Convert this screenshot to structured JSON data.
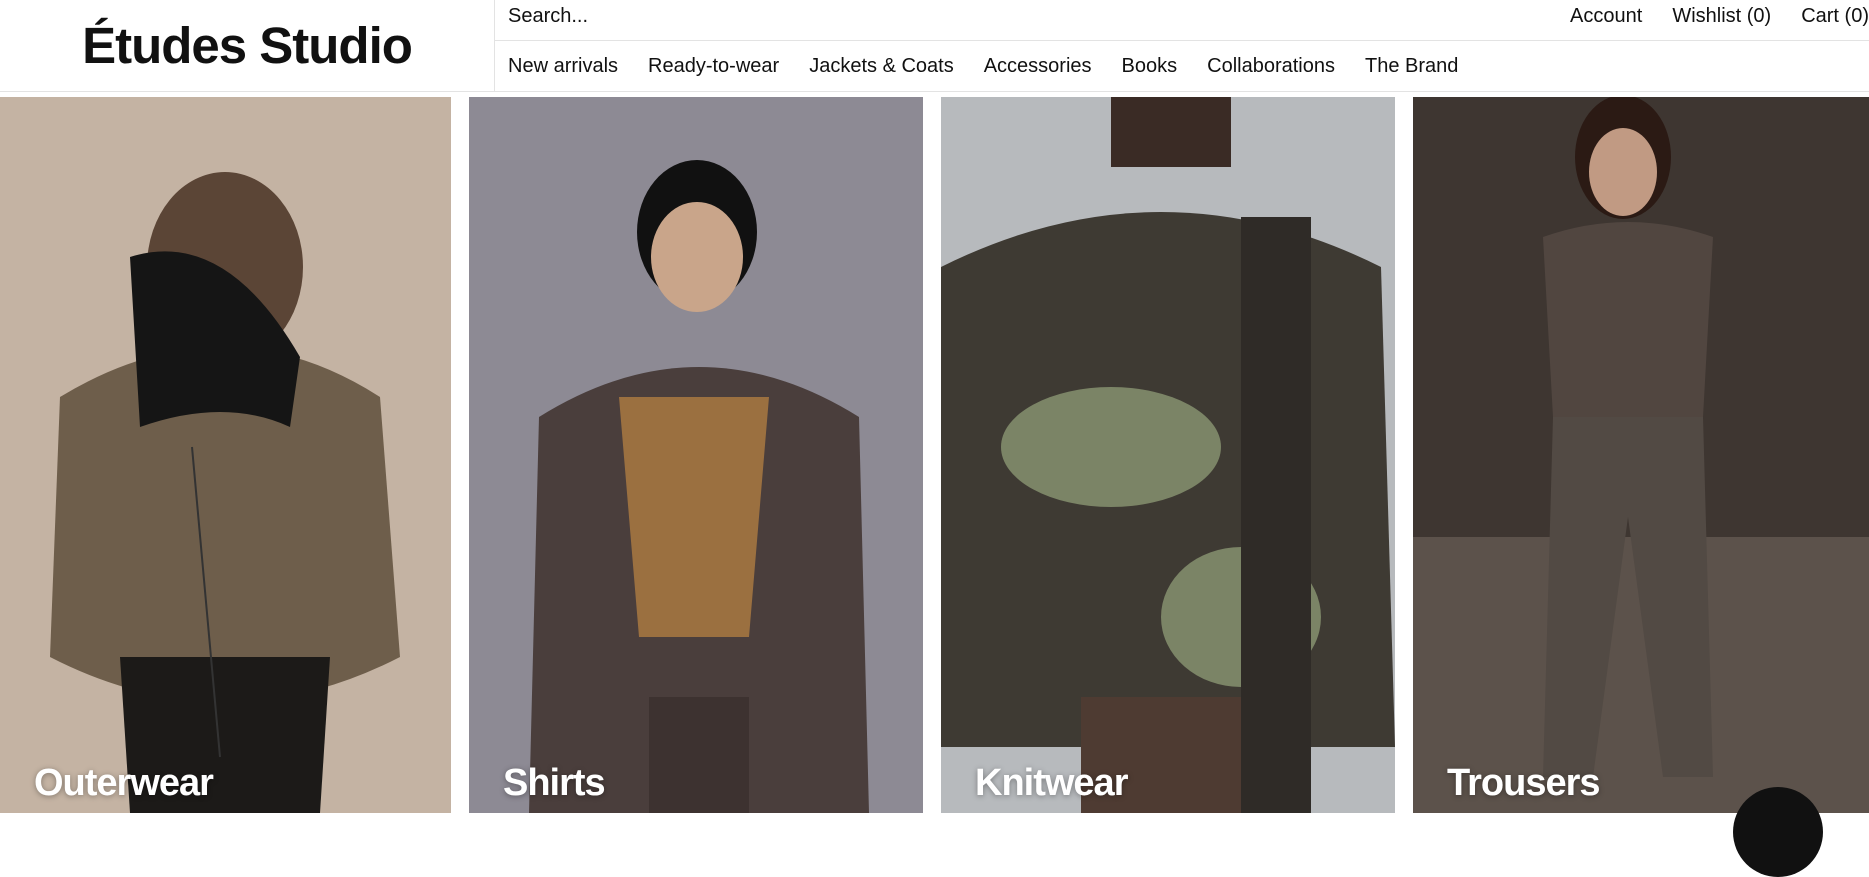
{
  "brand": {
    "logo_text": "Études Studio"
  },
  "search": {
    "placeholder": "Search..."
  },
  "account_links": {
    "account": "Account",
    "wishlist": "Wishlist (0)",
    "cart": "Cart (0)"
  },
  "nav": {
    "items": [
      {
        "label": "New arrivals"
      },
      {
        "label": "Ready-to-wear"
      },
      {
        "label": "Jackets & Coats"
      },
      {
        "label": "Accessories"
      },
      {
        "label": "Books"
      },
      {
        "label": "Collaborations"
      },
      {
        "label": "The Brand"
      }
    ]
  },
  "tiles": [
    {
      "label": "Outerwear",
      "bg": "#c4b3a3",
      "accent": "#6e5e4b"
    },
    {
      "label": "Shirts",
      "bg": "#8d8a94",
      "accent": "#4a3e3c"
    },
    {
      "label": "Knitwear",
      "bg": "#b7babd",
      "accent": "#3e3a33"
    },
    {
      "label": "Trousers",
      "bg": "#3e3631",
      "accent": "#514640"
    }
  ],
  "colors": {
    "text": "#111111",
    "divider": "#e3e3e3",
    "background": "#ffffff"
  }
}
